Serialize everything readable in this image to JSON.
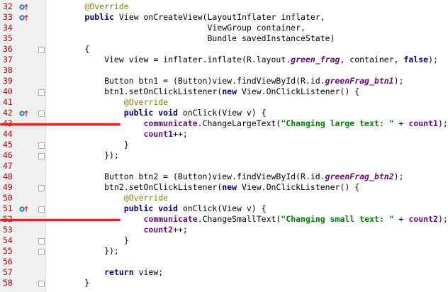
{
  "editor": {
    "lines": [
      {
        "num": "32",
        "icon": "override-icon",
        "fold": false,
        "tokens": [
          [
            "        ",
            ""
          ],
          [
            "@Override",
            "ann"
          ]
        ]
      },
      {
        "num": "33",
        "icon": "override-icon",
        "fold": false,
        "tokens": [
          [
            "        ",
            ""
          ],
          [
            "public",
            "kw"
          ],
          [
            " View onCreateView(LayoutInflater inflater,",
            ""
          ]
        ]
      },
      {
        "num": "34",
        "icon": "",
        "fold": false,
        "tokens": [
          [
            "                                 ViewGroup container,",
            ""
          ]
        ]
      },
      {
        "num": "35",
        "icon": "",
        "fold": false,
        "tokens": [
          [
            "                                 Bundle savedInstanceState)",
            ""
          ]
        ]
      },
      {
        "num": "36",
        "icon": "",
        "fold": true,
        "tokens": [
          [
            "        {",
            ""
          ]
        ]
      },
      {
        "num": "37",
        "icon": "",
        "fold": false,
        "tokens": [
          [
            "            View view = inflater.inflate(R.layout.",
            ""
          ],
          [
            "green_frag",
            "ital"
          ],
          [
            ", container, ",
            ""
          ],
          [
            "false",
            "kw"
          ],
          [
            ");",
            ""
          ]
        ]
      },
      {
        "num": "38",
        "icon": "",
        "fold": false,
        "tokens": [
          [
            "",
            ""
          ]
        ]
      },
      {
        "num": "39",
        "icon": "",
        "fold": false,
        "tokens": [
          [
            "            Button btn1 = (Button)view.findViewById(R.id.",
            ""
          ],
          [
            "greenFrag_btn1",
            "ital"
          ],
          [
            ");",
            ""
          ]
        ]
      },
      {
        "num": "40",
        "icon": "",
        "fold": true,
        "tokens": [
          [
            "            btn1.setOnClickListener(",
            ""
          ],
          [
            "new",
            "kw"
          ],
          [
            " View.OnClickListener() {",
            ""
          ]
        ]
      },
      {
        "num": "41",
        "icon": "",
        "fold": false,
        "tokens": [
          [
            "                ",
            ""
          ],
          [
            "@Override",
            "ann"
          ]
        ]
      },
      {
        "num": "42",
        "icon": "override-icon",
        "fold": true,
        "tokens": [
          [
            "                ",
            ""
          ],
          [
            "public void",
            "kw"
          ],
          [
            " onClick(View v) {",
            ""
          ]
        ]
      },
      {
        "num": "43",
        "icon": "",
        "fold": false,
        "tokens": [
          [
            "                    ",
            ""
          ],
          [
            "communicate",
            "fld"
          ],
          [
            ".ChangeLargeText(",
            ""
          ],
          [
            "\"Changing large text: \"",
            "str"
          ],
          [
            " + ",
            ""
          ],
          [
            "count1",
            "fld"
          ],
          [
            ");",
            ""
          ]
        ]
      },
      {
        "num": "44",
        "icon": "",
        "fold": false,
        "tokens": [
          [
            "                    ",
            ""
          ],
          [
            "count1",
            "fld"
          ],
          [
            "++;",
            ""
          ]
        ]
      },
      {
        "num": "45",
        "icon": "",
        "fold": true,
        "tokens": [
          [
            "                }",
            ""
          ]
        ]
      },
      {
        "num": "46",
        "icon": "",
        "fold": true,
        "tokens": [
          [
            "            });",
            ""
          ]
        ]
      },
      {
        "num": "47",
        "icon": "",
        "fold": false,
        "tokens": [
          [
            "",
            ""
          ]
        ]
      },
      {
        "num": "48",
        "icon": "",
        "fold": false,
        "tokens": [
          [
            "            Button btn2 = (Button)view.findViewById(R.id.",
            ""
          ],
          [
            "greenFrag_btn2",
            "ital"
          ],
          [
            ");",
            ""
          ]
        ]
      },
      {
        "num": "49",
        "icon": "",
        "fold": true,
        "tokens": [
          [
            "            btn2.setOnClickListener(",
            ""
          ],
          [
            "new",
            "kw"
          ],
          [
            " View.OnClickListener() {",
            ""
          ]
        ]
      },
      {
        "num": "50",
        "icon": "",
        "fold": false,
        "tokens": [
          [
            "                ",
            ""
          ],
          [
            "@Override",
            "ann"
          ]
        ]
      },
      {
        "num": "51",
        "icon": "override-icon",
        "fold": true,
        "tokens": [
          [
            "                ",
            ""
          ],
          [
            "public void",
            "kw"
          ],
          [
            " onClick(View v) {",
            ""
          ]
        ]
      },
      {
        "num": "52",
        "icon": "",
        "fold": false,
        "tokens": [
          [
            "                    ",
            ""
          ],
          [
            "communicate",
            "fld"
          ],
          [
            ".ChangeSmallText(",
            ""
          ],
          [
            "\"Changing small text: \"",
            "str"
          ],
          [
            " + ",
            ""
          ],
          [
            "count2",
            "fld"
          ],
          [
            ");",
            ""
          ]
        ]
      },
      {
        "num": "53",
        "icon": "",
        "fold": false,
        "tokens": [
          [
            "                    ",
            ""
          ],
          [
            "count2",
            "fld"
          ],
          [
            "++;",
            ""
          ]
        ]
      },
      {
        "num": "54",
        "icon": "",
        "fold": true,
        "tokens": [
          [
            "                }",
            ""
          ]
        ]
      },
      {
        "num": "55",
        "icon": "",
        "fold": true,
        "tokens": [
          [
            "            });",
            ""
          ]
        ]
      },
      {
        "num": "56",
        "icon": "",
        "fold": false,
        "tokens": [
          [
            "",
            ""
          ]
        ]
      },
      {
        "num": "57",
        "icon": "",
        "fold": false,
        "tokens": [
          [
            "            ",
            ""
          ],
          [
            "return",
            "kw"
          ],
          [
            " view;",
            ""
          ]
        ]
      },
      {
        "num": "58",
        "icon": "",
        "fold": true,
        "tokens": [
          [
            "        }",
            ""
          ]
        ]
      }
    ],
    "highlighted_lines": [
      "43",
      "52"
    ],
    "colors": {
      "line_number": "#c00000",
      "keyword": "#000080",
      "annotation": "#808000",
      "string": "#008000",
      "field": "#660e7a",
      "highlight_marker": "#ff1a1a"
    }
  }
}
